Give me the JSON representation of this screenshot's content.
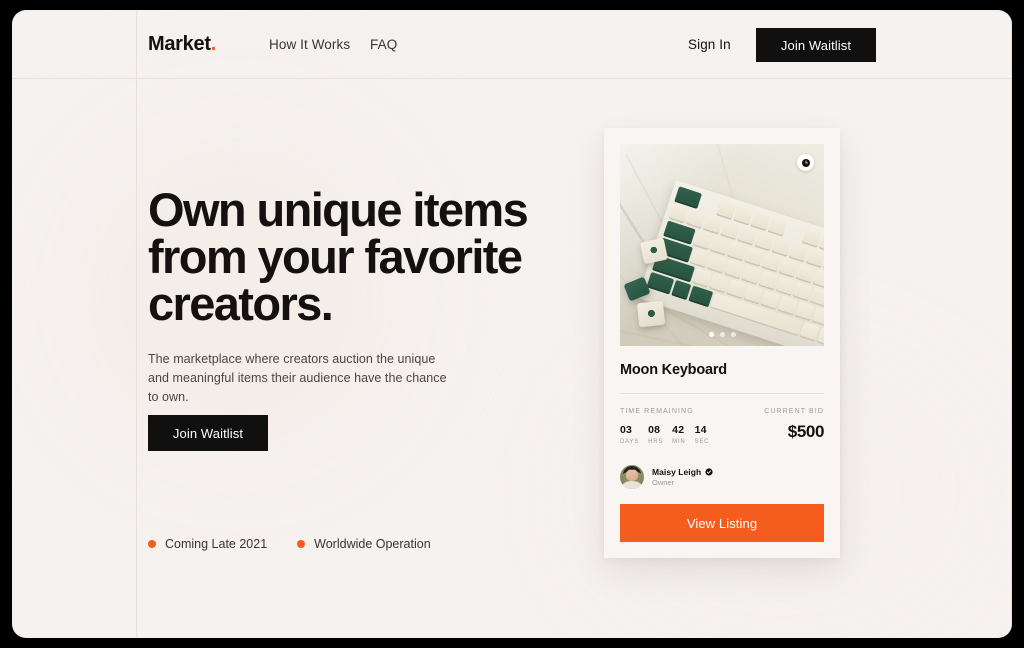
{
  "brand": {
    "name": "Market",
    "dot": "."
  },
  "nav": {
    "links": [
      {
        "label": "How It Works"
      },
      {
        "label": "FAQ"
      }
    ],
    "sign_in_label": "Sign In",
    "waitlist_label": "Join Waitlist"
  },
  "hero": {
    "headline": "Own unique items from your favorite creators.",
    "subtitle": "The marketplace where creators auction the unique and meaningful items their audience have the chance to own.",
    "cta_label": "Join Waitlist",
    "features": [
      {
        "label": "Coming Late 2021"
      },
      {
        "label": "Worldwide Operation"
      }
    ]
  },
  "product_card": {
    "image_alt": "Moon Keyboard product photo — mechanical keyboard with green and cream keycaps on marble",
    "badge_icon": "clock-icon",
    "carousel": {
      "dots": 3,
      "active_index": 0
    },
    "title": "Moon Keyboard",
    "time_remaining_label": "TIME REMAINING",
    "countdown": [
      {
        "value": "03",
        "unit": "DAYS"
      },
      {
        "value": "08",
        "unit": "HRS"
      },
      {
        "value": "42",
        "unit": "MIN"
      },
      {
        "value": "14",
        "unit": "SEC"
      }
    ],
    "current_bid_label": "CURRENT BID",
    "current_bid_amount": "$500",
    "owner": {
      "name": "Maisy Leigh",
      "role": "Owner",
      "verified_icon": "verified-check-icon"
    },
    "view_listing_label": "View Listing"
  },
  "colors": {
    "background": "#f6f2f0",
    "ink": "#14110f",
    "accent_orange": "#f45d1e",
    "muted": "#a39a95",
    "card": "#f8f5f3",
    "frame": "#000000"
  }
}
